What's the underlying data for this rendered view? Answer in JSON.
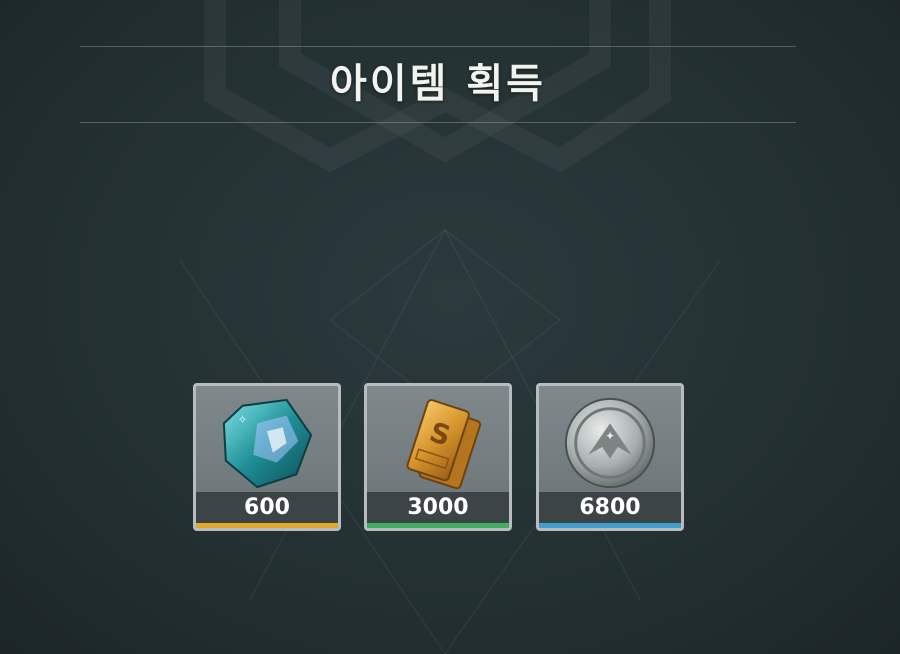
{
  "screen": {
    "title": "아이템 획득"
  },
  "rewards": [
    {
      "count": "600",
      "icon": "blue-crystal-icon",
      "rarity_color": "#e0a72a"
    },
    {
      "count": "3000",
      "icon": "gold-bar-icon",
      "rarity_color": "#3fae62"
    },
    {
      "count": "6800",
      "icon": "silver-coin-icon",
      "rarity_color": "#3f9fcf"
    }
  ]
}
